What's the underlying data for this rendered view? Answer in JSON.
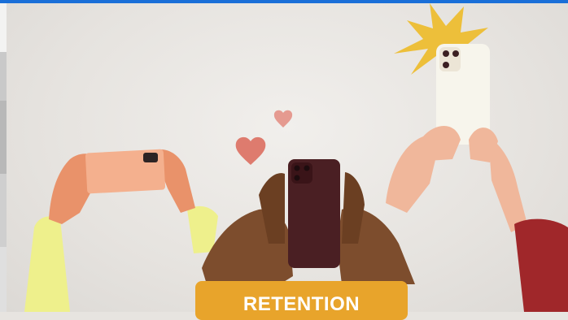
{
  "hero": {
    "cta_label": "RETENTION",
    "colors": {
      "cta_background": "#e8a42b",
      "cta_text": "#ffffff",
      "top_bar": "#1a6fd8"
    }
  },
  "icons": [
    "heart-icon",
    "starburst-icon"
  ]
}
